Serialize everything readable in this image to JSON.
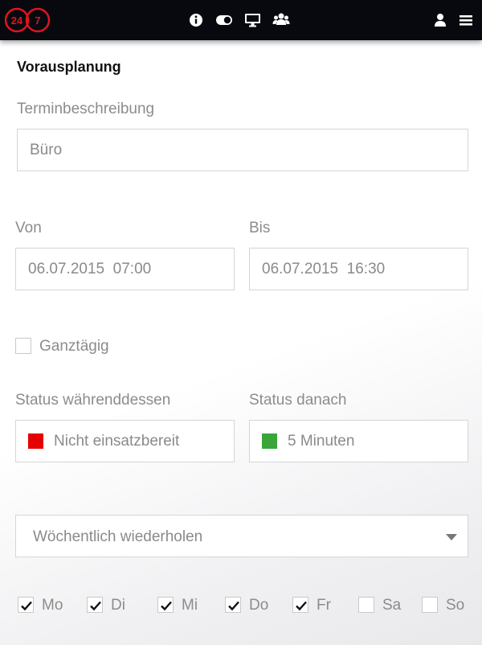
{
  "header": {
    "logo": {
      "left_text": "24",
      "right_text": "7",
      "color": "#e0141e"
    },
    "icons": [
      "info-icon",
      "toggle-icon",
      "monitor-icon",
      "users-icon",
      "user-icon",
      "menu-icon"
    ]
  },
  "page": {
    "title": "Vorausplanung"
  },
  "form": {
    "description": {
      "label": "Terminbeschreibung",
      "value": "Büro"
    },
    "from": {
      "label": "Von",
      "value": "06.07.2015  07:00"
    },
    "to": {
      "label": "Bis",
      "value": "06.07.2015  16:30"
    },
    "all_day": {
      "label": "Ganztägig",
      "checked": false
    },
    "status_during": {
      "label": "Status währenddessen",
      "value": "Nicht einsatzbereit",
      "color": "#e60000"
    },
    "status_after": {
      "label": "Status danach",
      "value": "5 Minuten",
      "color": "#3aa639"
    },
    "repeat": {
      "value": "Wöchentlich wiederholen"
    },
    "days": [
      {
        "label": "Mo",
        "checked": true
      },
      {
        "label": "Di",
        "checked": true
      },
      {
        "label": "Mi",
        "checked": true
      },
      {
        "label": "Do",
        "checked": true
      },
      {
        "label": "Fr",
        "checked": true
      },
      {
        "label": "Sa",
        "checked": false
      },
      {
        "label": "So",
        "checked": false
      }
    ]
  }
}
